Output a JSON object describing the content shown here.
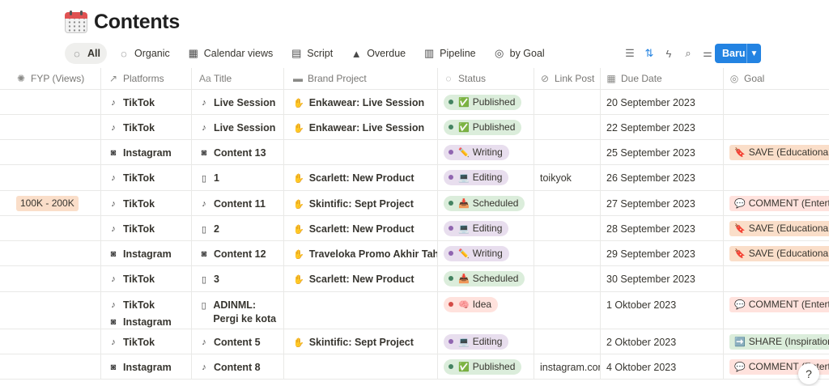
{
  "page": {
    "title": "Contents",
    "icon": "calendar-icon"
  },
  "tabs": [
    {
      "label": "All",
      "icon": "loader-icon",
      "active": true
    },
    {
      "label": "Organic",
      "icon": "dashed-circle-icon"
    },
    {
      "label": "Calendar views",
      "icon": "calendar-icon"
    },
    {
      "label": "Script",
      "icon": "table-icon"
    },
    {
      "label": "Overdue",
      "icon": "warning-icon"
    },
    {
      "label": "Pipeline",
      "icon": "board-icon"
    },
    {
      "label": "by Goal",
      "icon": "target-icon"
    }
  ],
  "toolbar": {
    "new_label": "Baru"
  },
  "columns": [
    {
      "label": "FYP (Views)",
      "icon": "sparkle-icon"
    },
    {
      "label": "Platforms",
      "icon": "arrow-up-right-icon"
    },
    {
      "label": "Title",
      "icon": "text-icon"
    },
    {
      "label": "Brand Project",
      "icon": "folder-icon"
    },
    {
      "label": "Status",
      "icon": "loader-icon"
    },
    {
      "label": "Link Post",
      "icon": "link-icon"
    },
    {
      "label": "Due Date",
      "icon": "calendar-icon"
    },
    {
      "label": "Goal",
      "icon": "target-icon"
    }
  ],
  "colors": {
    "accent": "#2383e2",
    "published_bg": "#dbeddb",
    "published_dot": "#448361",
    "writing_bg": "#e8deee",
    "writing_dot": "#9065b0",
    "editing_bg": "#e8deee",
    "editing_dot": "#9065b0",
    "scheduled_bg": "#dbeddb",
    "scheduled_dot": "#448361",
    "idea_bg": "#ffe2dd",
    "idea_dot": "#d44c47",
    "save_bg": "#fadec9",
    "comment_bg": "#ffe2dd",
    "share_bg": "#dbeddb",
    "fyp_bg": "#fadec9"
  },
  "rows": [
    {
      "fyp": "",
      "platforms": [
        {
          "name": "TikTok",
          "icon": "tiktok-icon"
        }
      ],
      "title": "Live Session",
      "title_icon": "tiktok-icon",
      "brand": "Enkawear: Live Session",
      "status": "Published",
      "status_icon": "✅",
      "status_type": "published",
      "link": "",
      "due": "20 September 2023",
      "goal": "",
      "goal_icon": "",
      "goal_type": ""
    },
    {
      "fyp": "",
      "platforms": [
        {
          "name": "TikTok",
          "icon": "tiktok-icon"
        }
      ],
      "title": "Live Session",
      "title_icon": "tiktok-icon",
      "brand": "Enkawear: Live Session",
      "status": "Published",
      "status_icon": "✅",
      "status_type": "published",
      "link": "",
      "due": "22 September 2023",
      "goal": "",
      "goal_icon": "",
      "goal_type": ""
    },
    {
      "fyp": "",
      "platforms": [
        {
          "name": "Instagram",
          "icon": "instagram-icon"
        }
      ],
      "title": "Content 13",
      "title_icon": "instagram-icon",
      "brand": "",
      "status": "Writing",
      "status_icon": "✏️",
      "status_type": "writing",
      "link": "",
      "due": "25 September 2023",
      "goal": "SAVE (Educational)",
      "goal_icon": "🔖",
      "goal_type": "save"
    },
    {
      "fyp": "",
      "platforms": [
        {
          "name": "TikTok",
          "icon": "tiktok-icon"
        }
      ],
      "title": "1",
      "title_icon": "doc-icon",
      "brand": "Scarlett: New Product",
      "status": "Editing",
      "status_icon": "💻",
      "status_type": "editing",
      "link": "toikyok",
      "due": "26 September 2023",
      "goal": "",
      "goal_icon": "",
      "goal_type": ""
    },
    {
      "fyp": "100K - 200K",
      "platforms": [
        {
          "name": "TikTok",
          "icon": "tiktok-icon"
        }
      ],
      "title": "Content 11",
      "title_icon": "tiktok-icon",
      "brand": "Skintific: Sept Project",
      "status": "Scheduled",
      "status_icon": "📥",
      "status_type": "scheduled",
      "link": "",
      "due": "27 September 2023",
      "goal": "COMMENT (Entertai",
      "goal_icon": "💬",
      "goal_type": "comment"
    },
    {
      "fyp": "",
      "platforms": [
        {
          "name": "TikTok",
          "icon": "tiktok-icon"
        }
      ],
      "title": "2",
      "title_icon": "doc-icon",
      "brand": "Scarlett: New Product",
      "status": "Editing",
      "status_icon": "💻",
      "status_type": "editing",
      "link": "",
      "due": "28 September 2023",
      "goal": "SAVE (Educational)",
      "goal_icon": "🔖",
      "goal_type": "save"
    },
    {
      "fyp": "",
      "platforms": [
        {
          "name": "Instagram",
          "icon": "instagram-icon"
        }
      ],
      "title": "Content 12",
      "title_icon": "instagram-icon",
      "brand": "Traveloka Promo Akhir Tahun",
      "status": "Writing",
      "status_icon": "✏️",
      "status_type": "writing",
      "link": "",
      "due": "29 September 2023",
      "goal": "SAVE (Educational)",
      "goal_icon": "🔖",
      "goal_type": "save"
    },
    {
      "fyp": "",
      "platforms": [
        {
          "name": "TikTok",
          "icon": "tiktok-icon"
        }
      ],
      "title": "3",
      "title_icon": "doc-icon",
      "brand": "Scarlett: New Product",
      "status": "Scheduled",
      "status_icon": "📥",
      "status_type": "scheduled",
      "link": "",
      "due": "30 September 2023",
      "goal": "",
      "goal_icon": "",
      "goal_type": ""
    },
    {
      "fyp": "",
      "platforms": [
        {
          "name": "TikTok",
          "icon": "tiktok-icon"
        },
        {
          "name": "Instagram",
          "icon": "instagram-icon"
        }
      ],
      "title": "ADINML: Pergi ke kota tua",
      "title_icon": "doc-icon",
      "brand": "",
      "status": "Idea",
      "status_icon": "🧠",
      "status_type": "idea",
      "link": "",
      "due": "1 Oktober 2023",
      "goal": "COMMENT (Entertai",
      "goal_icon": "💬",
      "goal_type": "comment"
    },
    {
      "fyp": "",
      "platforms": [
        {
          "name": "TikTok",
          "icon": "tiktok-icon"
        }
      ],
      "title": "Content 5",
      "title_icon": "tiktok-icon",
      "brand": "Skintific: Sept Project",
      "status": "Editing",
      "status_icon": "💻",
      "status_type": "editing",
      "link": "",
      "due": "2 Oktober 2023",
      "goal": "SHARE (Inspirationa",
      "goal_icon": "➡️",
      "goal_type": "share"
    },
    {
      "fyp": "",
      "platforms": [
        {
          "name": "Instagram",
          "icon": "instagram-icon"
        }
      ],
      "title": "Content 8",
      "title_icon": "tiktok-icon",
      "brand": "",
      "status": "Published",
      "status_icon": "✅",
      "status_type": "published",
      "link": "instagram.com",
      "due": "4 Oktober 2023",
      "goal": "COMMENT (Entertai",
      "goal_icon": "💬",
      "goal_type": "comment"
    }
  ]
}
